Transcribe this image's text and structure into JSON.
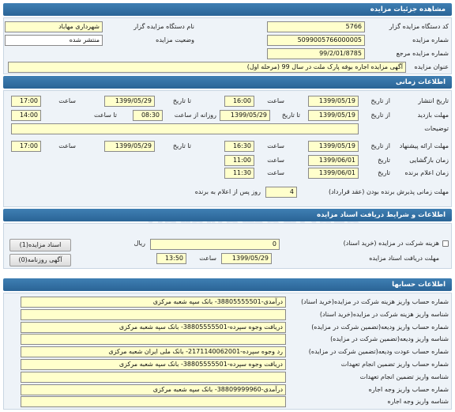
{
  "details": {
    "header": "مشاهده جزئیات مزایده",
    "auctioneer_code_label": "کد دستگاه مزایده گزار",
    "auctioneer_code": "5766",
    "auctioneer_name_label": "نام دستگاه مزایده گزار",
    "auctioneer_name": "شهرداری مهاباد",
    "auction_number_label": "شماره مزایده",
    "auction_number": "5099005766000005",
    "status_label": "وضعیت مزایده",
    "status": "منتشر شده",
    "reference_number_label": "شماره مزایده مرجع",
    "reference_number": "99/2/01/8785",
    "title_label": "عنوان مزایده",
    "title": "آگهی مزایده اجاره بوفه پارک ملت در سال 99 (مرحله اول)"
  },
  "timing": {
    "header": "اطلاعات زمانی",
    "from_date": "از تاریخ",
    "to_date": "تا تاریخ",
    "time": "ساعت",
    "to_time": "تا ساعت",
    "daily_from_time": "روزانه از ساعت",
    "date": "تاریخ",
    "publish_label": "تاریخ انتشار",
    "publish_from_date": "1399/05/19",
    "publish_from_time": "16:00",
    "publish_to_date": "1399/05/29",
    "publish_to_time": "17:00",
    "visit_label": "مهلت بازدید",
    "visit_from_date": "1399/05/19",
    "visit_to_date": "1399/05/29",
    "visit_daily_from": "08:30",
    "visit_daily_to": "14:00",
    "notes_label": "توضیحات",
    "notes": "",
    "proposal_label": "مهلت ارائه پیشنهاد",
    "proposal_from_date": "1399/05/19",
    "proposal_from_time": "16:30",
    "proposal_to_date": "1399/05/29",
    "proposal_to_time": "17:00",
    "opening_label": "زمان بازگشایی",
    "opening_date": "1399/06/01",
    "opening_time": "11:00",
    "winner_label": "زمان اعلام برنده",
    "winner_date": "1399/06/01",
    "winner_time": "11:30",
    "acceptance_label": "مهلت زمانی پذیرش برنده بودن (عقد قرارداد)",
    "acceptance_days": "4",
    "acceptance_suffix": "روز پس از اعلام به برنده"
  },
  "docs": {
    "header": "اطلاعات و شرایط دریافت اسناد مزایده",
    "fee_label": "هزینه شرکت در مزایده (خرید اسناد)",
    "fee_value": "0",
    "currency": "ریال",
    "deadline_label": "مهلت دریافت اسناد مزایده",
    "deadline_date": "1399/05/29",
    "deadline_time": "13:50",
    "documents_button": "اسناد مزایده(1)",
    "newspaper_button": "آگهی روزنامه(0)"
  },
  "accounts": {
    "header": "اطلاعات حسابها",
    "rows": [
      {
        "label": "شماره حساب واریز هزینه شرکت در مزایده(خرید اسناد)",
        "value": "درآمدی-38805555501- بانک سپه شعبه مرکزی"
      },
      {
        "label": "شناسه واریز هزینه شرکت در مزایده(خرید اسناد)",
        "value": ""
      },
      {
        "label": "شماره حساب واریز ودیعه(تضمین شرکت در مزایده)",
        "value": "دریافت وجوه سپرده-38805555501- بانک سپه شعبه مرکزی"
      },
      {
        "label": "شناسه واریز ودیعه(تضمین شرکت در مزایده)",
        "value": ""
      },
      {
        "label": "شماره حساب عودت ودیعه(تضمین شرکت در مزایده)",
        "value": "رد وجوه سپرده-2171140062001- بانک ملی ایران شعبه مرکزی"
      },
      {
        "label": "شماره حساب واریز تضمین انجام تعهدات",
        "value": "دریافت وجوه سپرده-38805555501- بانک سپه شعبه مرکزی"
      },
      {
        "label": "شناسه واریز تضمین انجام تعهدات",
        "value": ""
      },
      {
        "label": "شماره حساب واریز وجه اجاره",
        "value": "درآمدی-38809999960- بانک سپه شعبه مرکزی"
      },
      {
        "label": "شناسه واریز وجه اجاره",
        "value": ""
      }
    ]
  },
  "watermark": {
    "line1": "0910",
    "line2": "1001",
    "line3": "ParsNamadData"
  }
}
